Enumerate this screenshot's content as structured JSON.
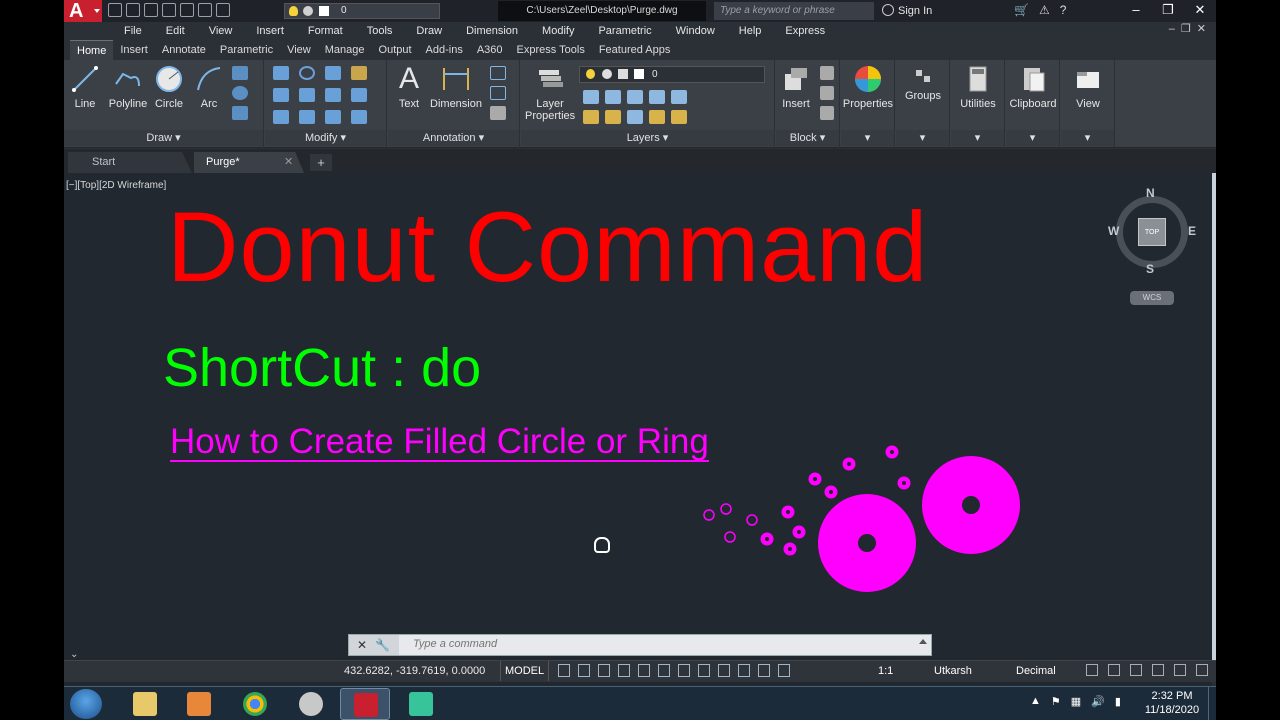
{
  "titlebar": {
    "logo_letter": "A",
    "layer_value": "0",
    "file_path": "C:\\Users\\Zeel\\Desktop\\Purge.dwg",
    "search_placeholder": "Type a keyword or phrase",
    "sign_in": "Sign In"
  },
  "menubar": [
    "File",
    "Edit",
    "View",
    "Insert",
    "Format",
    "Tools",
    "Draw",
    "Dimension",
    "Modify",
    "Parametric",
    "Window",
    "Help",
    "Express"
  ],
  "ribbon_tabs": [
    "Home",
    "Insert",
    "Annotate",
    "Parametric",
    "View",
    "Manage",
    "Output",
    "Add-ins",
    "A360",
    "Express Tools",
    "Featured Apps"
  ],
  "ribbon": {
    "draw_tools": [
      "Line",
      "Polyline",
      "Circle",
      "Arc"
    ],
    "text_label": "Text",
    "dimension_label": "Dimension",
    "layer_properties_line1": "Layer",
    "layer_properties_line2": "Properties",
    "layer_value": "0",
    "insert_label": "Insert",
    "properties_label": "Properties",
    "groups_label": "Groups",
    "utilities_label": "Utilities",
    "clipboard_label": "Clipboard",
    "view_label": "View",
    "panels": {
      "draw": "Draw",
      "modify": "Modify",
      "annotation": "Annotation",
      "layers": "Layers",
      "block": "Block"
    }
  },
  "file_tabs": {
    "start": "Start",
    "current": "Purge*",
    "new_tab": "+"
  },
  "viewport": {
    "controls": "[−][Top][2D Wireframe]",
    "heading": "Donut Command",
    "shortcut": "ShortCut : do",
    "subtitle": "How to Create Filled Circle or Ring",
    "compass": {
      "n": "N",
      "s": "S",
      "e": "E",
      "w": "W",
      "top": "TOP"
    },
    "wcs": "WCS",
    "colors": {
      "heading": "#ff0000",
      "shortcut": "#00ff00",
      "subtitle": "#ff00ff",
      "donut": "#ff00ff"
    }
  },
  "command_line": {
    "placeholder": "Type a command"
  },
  "statusbar": {
    "coords": "432.6282, -319.7619, 0.0000",
    "model": "MODEL",
    "scale": "1:1",
    "user": "Utkarsh",
    "units": "Decimal"
  },
  "taskbar": {
    "time": "2:32 PM",
    "date": "11/18/2020",
    "apps": [
      "explorer-icon",
      "media-player-icon",
      "chrome-icon",
      "snipping-tool-icon",
      "autocad-icon",
      "filmora-icon"
    ]
  }
}
